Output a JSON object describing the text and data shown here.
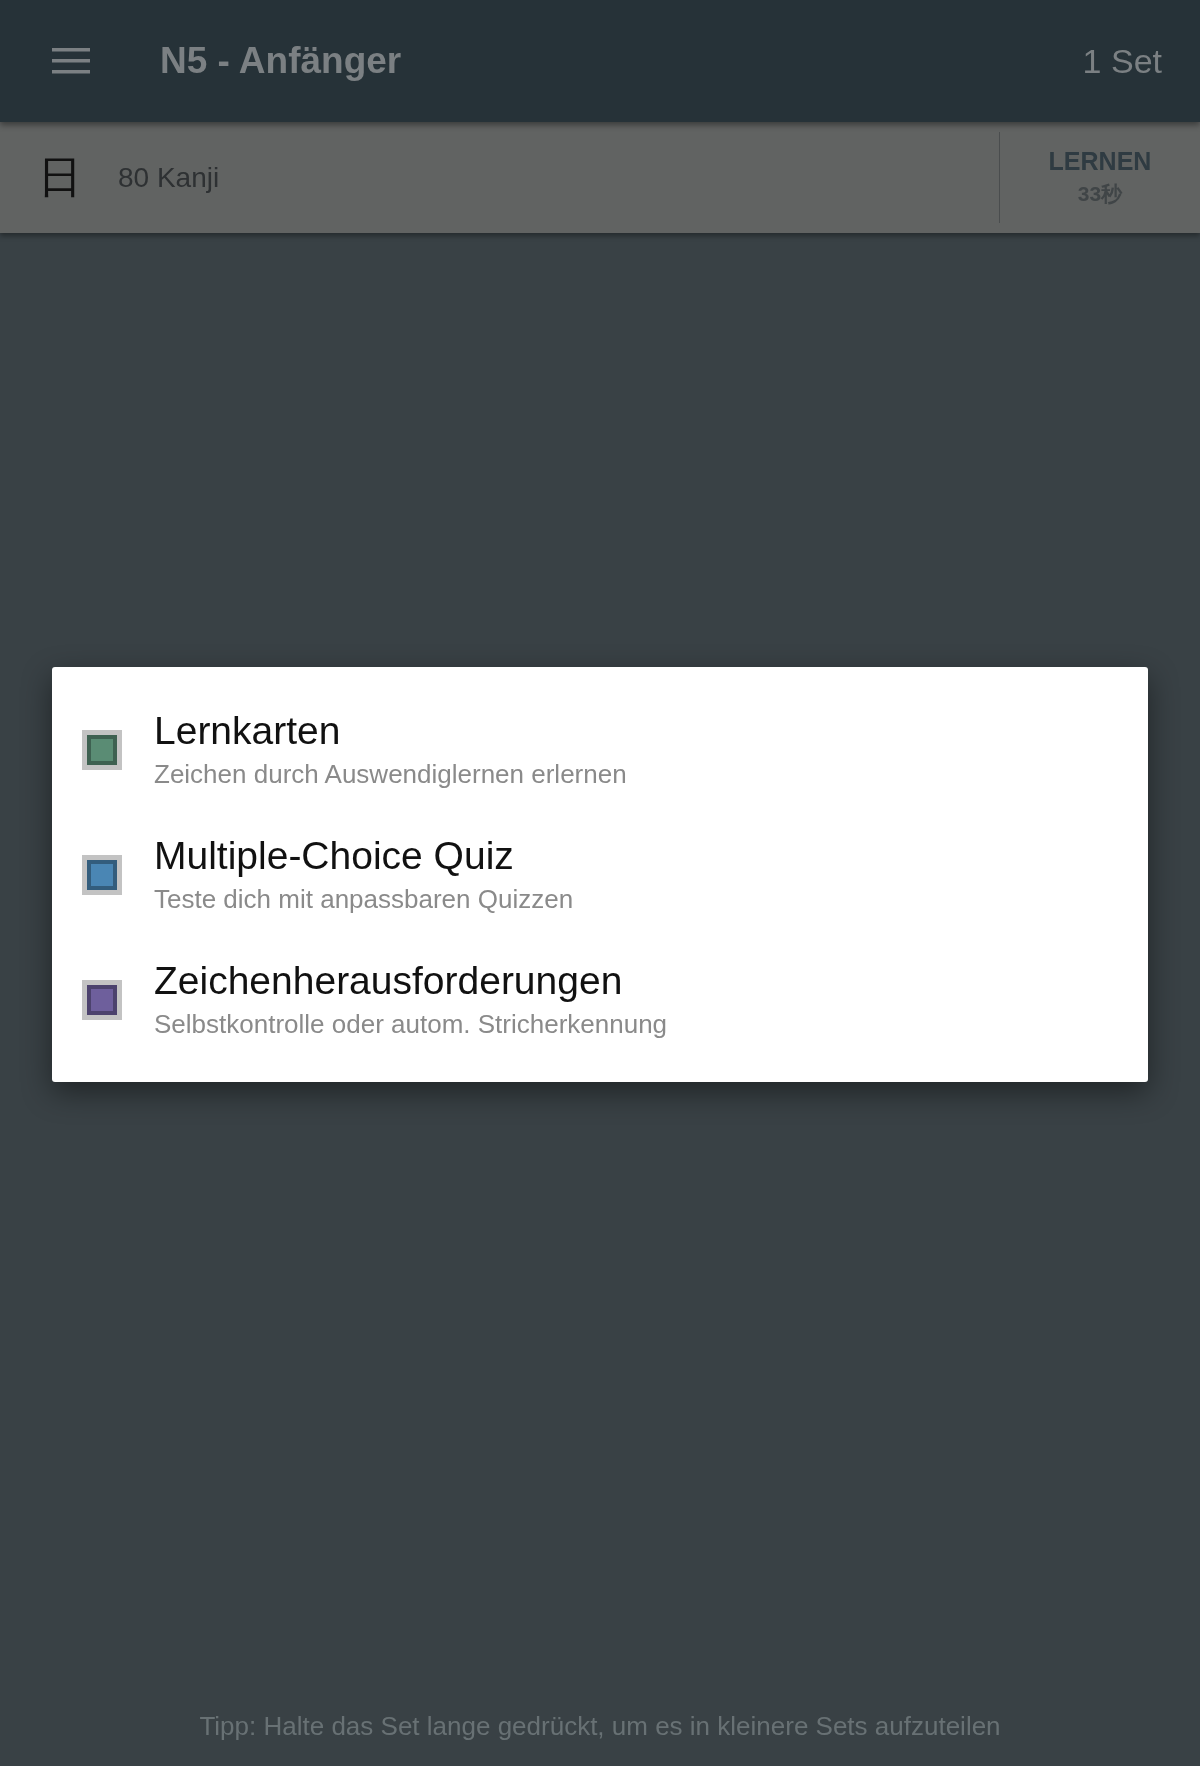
{
  "app_bar": {
    "title": "N5 - Anfänger",
    "count": "1 Set"
  },
  "set_row": {
    "glyph": "日",
    "label": "80 Kanji",
    "action": "LERNEN",
    "time": "33秒"
  },
  "dialog": {
    "options": [
      {
        "title": "Lernkarten",
        "subtitle": "Zeichen durch Auswendiglernen erlernen",
        "color": "#5a8c74"
      },
      {
        "title": "Multiple-Choice Quiz",
        "subtitle": "Teste dich mit anpassbaren Quizzen",
        "color": "#4a86b4"
      },
      {
        "title": "Zeichenherausforderungen",
        "subtitle": "Selbstkontrolle oder autom. Stricherkennung",
        "color": "#6e5f9c"
      }
    ]
  },
  "tip": "Tipp: Halte das Set lange gedrückt, um es in kleinere Sets aufzuteilen"
}
